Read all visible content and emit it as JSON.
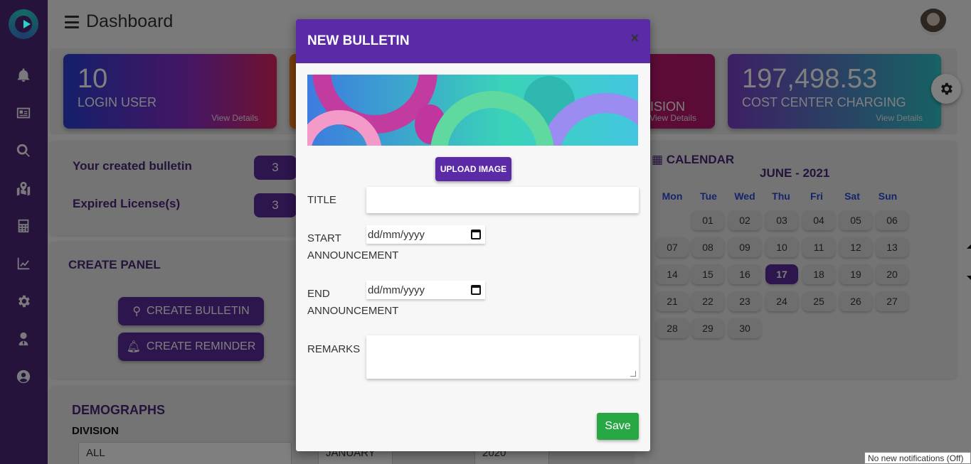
{
  "header": {
    "title": "Dashboard"
  },
  "stats": [
    {
      "value": "10",
      "label": "LOGIN USER",
      "link": "View Details"
    },
    {
      "value": "",
      "label": "ISION",
      "link": "View Details"
    },
    {
      "value": "197,498.53",
      "label": "COST CENTER CHARGING",
      "link": "View Details"
    }
  ],
  "bulletin_panel": {
    "created_label": "Your created bulletin",
    "created_count": "3",
    "expired_label": "Expired License(s)",
    "expired_count": "3"
  },
  "create_panel": {
    "title": "CREATE PANEL",
    "create_bulletin": "CREATE BULLETIN",
    "create_reminder": "CREATE REMINDER"
  },
  "demographs": {
    "title": "DEMOGRAPHS",
    "division_label": "DIVISION",
    "division_value": "ALL",
    "month_value": "JANUARY",
    "year_value": "2020"
  },
  "calendar": {
    "title": "CALENDAR",
    "month_label": "JUNE - 2021",
    "weekdays": [
      "Mon",
      "Tue",
      "Wed",
      "Thu",
      "Fri",
      "Sat",
      "Sun"
    ],
    "rows": [
      [
        "",
        "01",
        "02",
        "03",
        "04",
        "05",
        "06"
      ],
      [
        "07",
        "08",
        "09",
        "10",
        "11",
        "12",
        "13"
      ],
      [
        "14",
        "15",
        "16",
        "17",
        "18",
        "19",
        "20"
      ],
      [
        "21",
        "22",
        "23",
        "24",
        "25",
        "26",
        "27"
      ],
      [
        "28",
        "29",
        "30",
        "",
        "",
        "",
        ""
      ]
    ],
    "today": "17"
  },
  "modal": {
    "title": "NEW BULLETIN",
    "close": "×",
    "upload_label": "UPLOAD IMAGE",
    "title_label": "TITLE",
    "start_label_1": "START",
    "start_label_2": "ANNOUNCEMENT",
    "end_label_1": "END",
    "end_label_2": "ANNOUNCEMENT",
    "date_placeholder": "dd/mm/yyyy",
    "remarks_label": "REMARKS",
    "save_label": "Save"
  },
  "toast": "No new notifications (Off)",
  "colors": {
    "brand": "#4a2777",
    "accent": "#5b2aa6",
    "save": "#28a745"
  }
}
